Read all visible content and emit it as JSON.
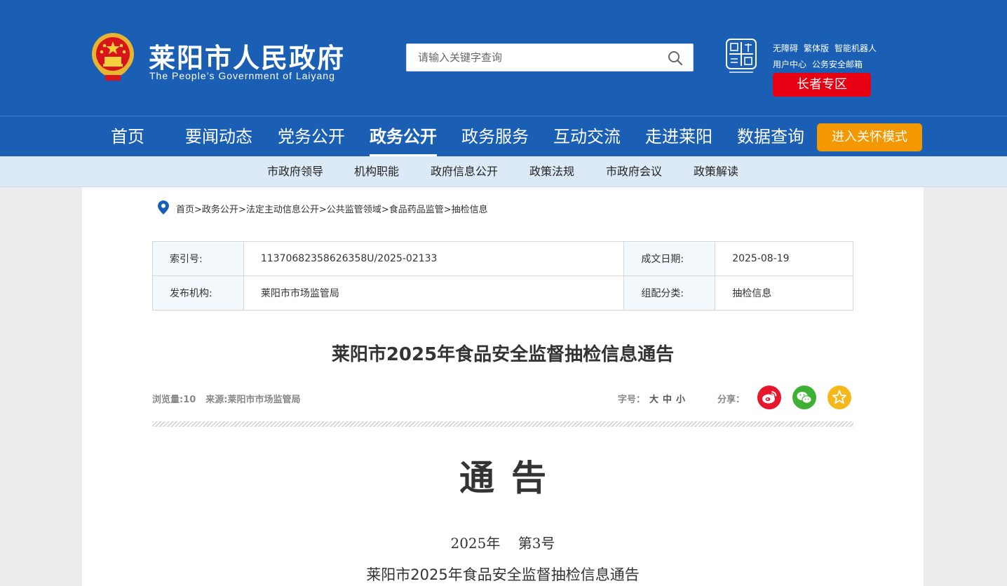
{
  "header": {
    "title": "莱阳市人民政府",
    "subtitle": "The People’s Government of Laiyang",
    "search_placeholder": "请输入关键字查询",
    "links_row1": [
      "无障碍",
      "繁体版",
      "智能机器人"
    ],
    "links_row2": [
      "用户中心",
      "公务安全邮箱"
    ],
    "elder_zone": "长者专区",
    "colors": {
      "primary": "#1a5fb4",
      "red": "#e60012",
      "orange": "#f39800"
    }
  },
  "nav": {
    "items": [
      "首页",
      "要闻动态",
      "党务公开",
      "政务公开",
      "政务服务",
      "互动交流",
      "走进莱阳",
      "数据查询"
    ],
    "active": "政务公开",
    "care_mode": "进入关怀模式"
  },
  "subnav": {
    "items": [
      "市政府领导",
      "机构职能",
      "政府信息公开",
      "政策法规",
      "市政府会议",
      "政策解读"
    ]
  },
  "breadcrumb": [
    "首页",
    "政务公开",
    "法定主动信息公开",
    "公共监管领域",
    "食品药品监管",
    "抽检信息"
  ],
  "meta": {
    "index_label": "索引号:",
    "index_value": "11370682358626358U/2025-02133",
    "date_label": "成文日期:",
    "date_value": "2025-08-19",
    "publisher_label": "发布机构:",
    "publisher_value": "莱阳市市场监管局",
    "category_label": "组配分类:",
    "category_value": "抽检信息"
  },
  "article": {
    "title": "莱阳市2025年食品安全监督抽检信息通告",
    "views": "浏览量:10",
    "source": "来源:莱阳市市场监管局",
    "font_label": "字号：",
    "font_sizes": [
      "大",
      "中",
      "小"
    ],
    "share_label": "分享：",
    "share_icons": [
      "weibo-icon",
      "wechat-icon",
      "favorite-icon"
    ],
    "notice_heading": "通告",
    "notice_number": "2025年    第3号",
    "notice_subtitle": "莱阳市2025年食品安全监督抽检信息通告"
  }
}
